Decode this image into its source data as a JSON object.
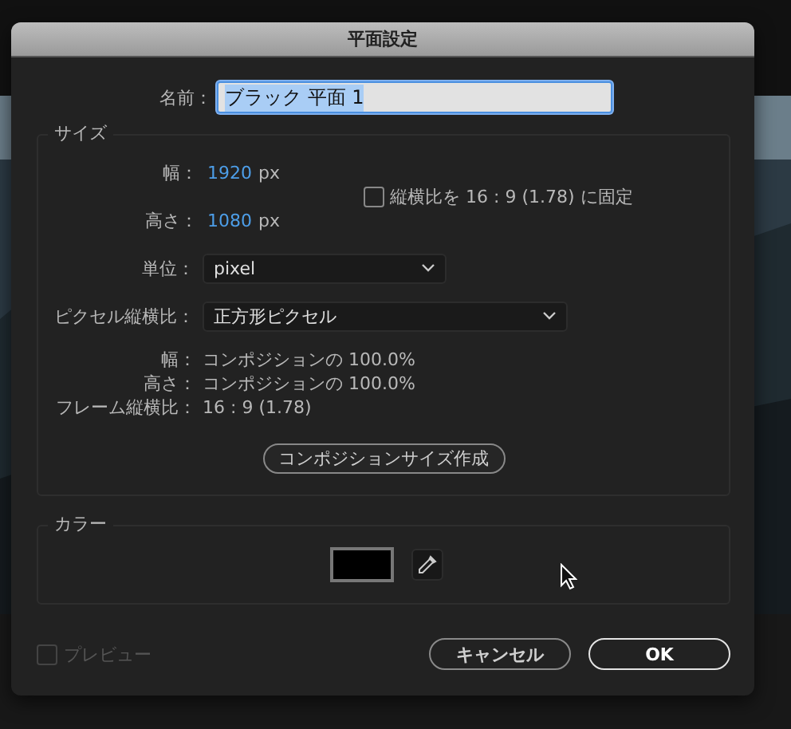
{
  "window": {
    "title": "平面設定"
  },
  "name": {
    "label": "名前：",
    "value": "ブラック 平面 1",
    "highlighted": true
  },
  "size": {
    "legend": "サイズ",
    "width": {
      "label": "幅：",
      "value": "1920",
      "unit": "px"
    },
    "height": {
      "label": "高さ：",
      "value": "1080",
      "unit": "px"
    },
    "lock_aspect": {
      "label": "縦横比を 16 : 9 (1.78) に固定",
      "checked": false
    },
    "units": {
      "label": "単位：",
      "value": "pixel"
    },
    "pixel_aspect": {
      "label": "ピクセル縦横比：",
      "value": "正方形ピクセル"
    },
    "info": [
      {
        "label": "幅：",
        "value": "コンポジションの 100.0%"
      },
      {
        "label": "高さ：",
        "value": "コンポジションの 100.0%"
      },
      {
        "label": "フレーム縦横比：",
        "value": "16 : 9 (1.78)"
      }
    ],
    "button": "コンポジションサイズ作成"
  },
  "color": {
    "legend": "カラー",
    "color": "#000000"
  },
  "preview": {
    "label": "プレビュー",
    "checked": false,
    "disabled": true
  },
  "buttons": [
    {
      "label": "キャンセル",
      "kind": "secondary"
    },
    {
      "label": "OK",
      "kind": "default"
    }
  ]
}
